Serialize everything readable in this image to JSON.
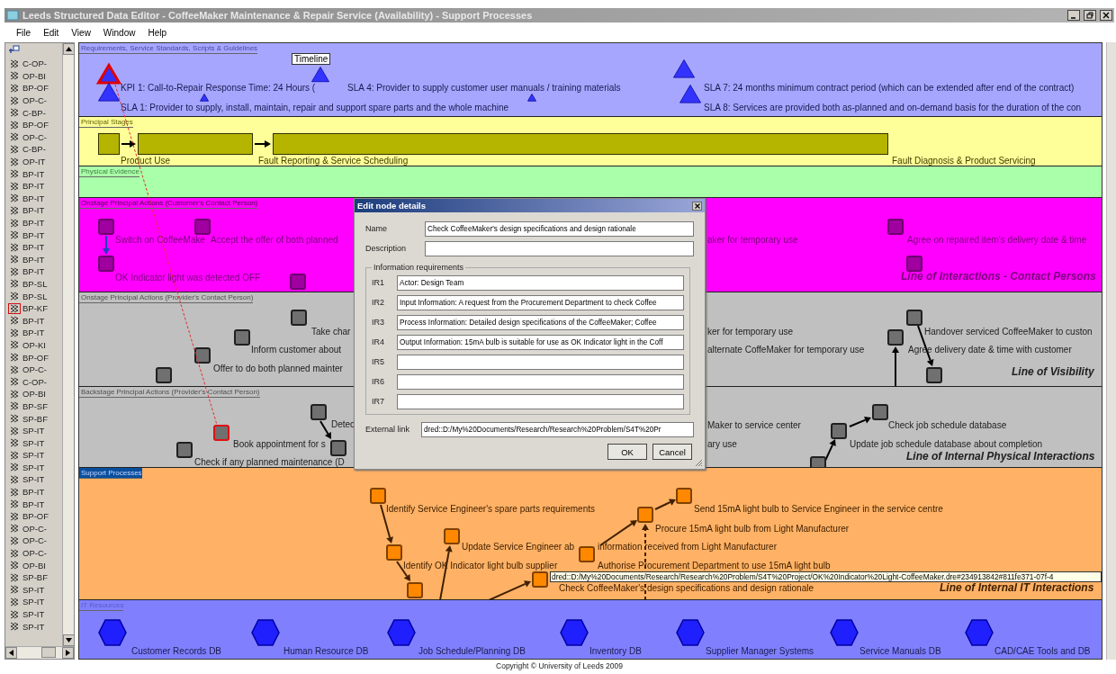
{
  "window": {
    "title": "Leeds Structured Data Editor - CoffeeMaker Maintenance & Repair Service (Availability) - Support Processes"
  },
  "menu": [
    "File",
    "Edit",
    "View",
    "Window",
    "Help"
  ],
  "tree": [
    {
      "label": "C-OP-",
      "selected": false
    },
    {
      "label": "OP-BI",
      "selected": false
    },
    {
      "label": "BP-OF",
      "selected": false
    },
    {
      "label": "OP-C-",
      "selected": false
    },
    {
      "label": "C-BP-",
      "selected": false
    },
    {
      "label": "BP-OF",
      "selected": false
    },
    {
      "label": "OP-C-",
      "selected": false
    },
    {
      "label": "C-BP-",
      "selected": false
    },
    {
      "label": "OP-IT",
      "selected": false
    },
    {
      "label": "BP-IT",
      "selected": false
    },
    {
      "label": "BP-IT",
      "selected": false
    },
    {
      "label": "BP-IT",
      "selected": false
    },
    {
      "label": "BP-IT",
      "selected": false
    },
    {
      "label": "BP-IT",
      "selected": false
    },
    {
      "label": "BP-IT",
      "selected": false
    },
    {
      "label": "BP-IT",
      "selected": false
    },
    {
      "label": "BP-IT",
      "selected": false
    },
    {
      "label": "BP-IT",
      "selected": false
    },
    {
      "label": "BP-SL",
      "selected": false
    },
    {
      "label": "BP-SL",
      "selected": false
    },
    {
      "label": "BP-KF",
      "selected": true
    },
    {
      "label": "BP-IT",
      "selected": false
    },
    {
      "label": "BP-IT",
      "selected": false
    },
    {
      "label": "OP-KI",
      "selected": false
    },
    {
      "label": "BP-OF",
      "selected": false
    },
    {
      "label": "OP-C-",
      "selected": false
    },
    {
      "label": "C-OP-",
      "selected": false
    },
    {
      "label": "OP-BI",
      "selected": false
    },
    {
      "label": "BP-SF",
      "selected": false
    },
    {
      "label": "SP-BF",
      "selected": false
    },
    {
      "label": "SP-IT",
      "selected": false
    },
    {
      "label": "SP-IT",
      "selected": false
    },
    {
      "label": "SP-IT",
      "selected": false
    },
    {
      "label": "SP-IT",
      "selected": false
    },
    {
      "label": "SP-IT",
      "selected": false
    },
    {
      "label": "BP-IT",
      "selected": false
    },
    {
      "label": "BP-IT",
      "selected": false
    },
    {
      "label": "BP-OF",
      "selected": false
    },
    {
      "label": "OP-C-",
      "selected": false
    },
    {
      "label": "OP-C-",
      "selected": false
    },
    {
      "label": "OP-C-",
      "selected": false
    },
    {
      "label": "OP-BI",
      "selected": false
    },
    {
      "label": "SP-BF",
      "selected": false
    },
    {
      "label": "SP-IT",
      "selected": false
    },
    {
      "label": "SP-IT",
      "selected": false
    },
    {
      "label": "SP-IT",
      "selected": false
    },
    {
      "label": "SP-IT",
      "selected": false
    }
  ],
  "lanes": [
    {
      "kind": "requirements",
      "title": "Requirements, Service Standards, Scripts & Guidelines",
      "nodes": [
        {
          "selected": true
        },
        {
          "selected": false
        },
        {
          "selected": false
        },
        {
          "selected": false
        },
        {
          "selected": false
        },
        {
          "selected": false
        },
        {
          "selected": false
        }
      ],
      "labels": [
        {
          "kind": "tag",
          "text": "Timeline"
        },
        {
          "kind": "caption",
          "text": "KPI 1: Call-to-Repair Response Time: 24 Hours ("
        },
        {
          "kind": "caption",
          "text": "SLA 4: Provider to supply customer user manuals / training materials"
        },
        {
          "kind": "caption",
          "text": "SLA 7: 24 months minimum contract period (which can be extended after end of the contract)"
        },
        {
          "kind": "caption",
          "text": "SLA 1: Provider to supply, install, maintain, repair and support spare parts and the whole machine"
        },
        {
          "kind": "caption",
          "text": "SLA 8: Services are provided both as-planned and on-demand basis for the duration of the con"
        }
      ]
    },
    {
      "kind": "stages",
      "title": "Principal Stages",
      "nodes": [
        {
          "selected": false
        },
        {
          "selected": false
        },
        {
          "selected": false
        }
      ],
      "labels": [
        {
          "kind": "caption",
          "text": "Product Use"
        },
        {
          "kind": "caption",
          "text": "Fault Reporting & Service Scheduling"
        },
        {
          "kind": "caption",
          "text": "Fault Diagnosis & Product Servicing"
        }
      ]
    },
    {
      "kind": "evidence",
      "title": "Physical Evidence"
    },
    {
      "kind": "customer",
      "title": "Onstage Principal Actions (Customer's Contact Person)",
      "nodes": [
        {
          "selected": false
        },
        {
          "selected": false
        },
        {
          "selected": false
        },
        {
          "selected": false
        },
        {
          "selected": false
        },
        {
          "selected": false
        }
      ],
      "labels": [
        {
          "kind": "caption",
          "text": "Switch on CoffeeMake"
        },
        {
          "kind": "caption",
          "text": "Accept the offer of both planned"
        },
        {
          "kind": "caption",
          "text": "aker for temporary use"
        },
        {
          "kind": "caption",
          "text": "Agree on repaired item's delivery date & time"
        },
        {
          "kind": "caption",
          "text": "OK Indicator light was detected OFF"
        },
        {
          "kind": "line",
          "text": "Line of Interactions - Contact Persons"
        }
      ]
    },
    {
      "kind": "provider",
      "title": "Onstage Principal Actions (Provider's Contact Person)",
      "nodes": [
        {
          "selected": false
        },
        {
          "selected": false
        },
        {
          "selected": false
        },
        {
          "selected": false
        },
        {
          "selected": false
        },
        {
          "selected": false
        },
        {
          "selected": false
        }
      ],
      "labels": [
        {
          "kind": "caption",
          "text": "Take char"
        },
        {
          "kind": "caption",
          "text": "Inform customer about"
        },
        {
          "kind": "caption",
          "text": "Offer to do both planned mainter"
        },
        {
          "kind": "caption",
          "text": "ker for temporary use"
        },
        {
          "kind": "caption",
          "text": "alternate CoffeMaker for temporary use"
        },
        {
          "kind": "caption",
          "text": "Handover serviced CoffeeMaker to custon"
        },
        {
          "kind": "caption",
          "text": "Agree delivery date & time with customer"
        },
        {
          "kind": "line",
          "text": "Line of Visibility"
        }
      ]
    },
    {
      "kind": "backstage",
      "title": "Backstage Principal Actions (Provider's Contact Person)",
      "nodes": [
        {
          "selected": false
        },
        {
          "selected": true
        },
        {
          "selected": false
        },
        {
          "selected": false
        },
        {
          "selected": false
        },
        {
          "selected": false
        },
        {
          "selected": false
        }
      ],
      "labels": [
        {
          "kind": "caption",
          "text": "Detec"
        },
        {
          "kind": "caption",
          "text": "Book appointment for s"
        },
        {
          "kind": "caption",
          "text": "Check if any planned maintenance (D"
        },
        {
          "kind": "caption",
          "text": "Maker to service center"
        },
        {
          "kind": "caption",
          "text": "ary use"
        },
        {
          "kind": "caption",
          "text": "Check job schedule database"
        },
        {
          "kind": "caption",
          "text": "Update job schedule database about completion"
        },
        {
          "kind": "line",
          "text": "Line of Internal Physical Interactions"
        }
      ]
    },
    {
      "kind": "support",
      "title": "Support Processes",
      "nodes": [
        {
          "selected": false
        },
        {
          "selected": false
        },
        {
          "selected": false
        },
        {
          "selected": false
        },
        {
          "selected": false
        },
        {
          "selected": false
        },
        {
          "selected": false
        },
        {
          "selected": false
        }
      ],
      "labels": [
        {
          "kind": "caption",
          "text": "Identify Service Engineer's spare parts requirements"
        },
        {
          "kind": "caption",
          "text": "Send 15mA light bulb to Service Engineer in the service centre"
        },
        {
          "kind": "caption",
          "text": "Procure 15mA light bulb from Light Manufacturer"
        },
        {
          "kind": "caption",
          "text": "Update Service Engineer ab"
        },
        {
          "kind": "caption",
          "text": "information received from Light Manufacturer"
        },
        {
          "kind": "caption",
          "text": "Identify OK Indicator light bulb supplier"
        },
        {
          "kind": "caption",
          "text": "Authorise Procurement Department to use 15mA light bulb"
        },
        {
          "kind": "caption",
          "text": "Check CoffeeMaker's design specifications and design rationale"
        },
        {
          "kind": "line",
          "text": "Line of Internal IT Interactions"
        }
      ],
      "tooltip": "dred::D:/My%20Documents/Research/Research%20Problem/S4T%20Project/OK%20Indicator%20Light-CoffeeMaker.dre#234913842#811fe371-07f-4"
    },
    {
      "kind": "resources",
      "title": "IT Resources",
      "nodes": [
        {
          "selected": false
        },
        {
          "selected": false
        },
        {
          "selected": false
        },
        {
          "selected": false
        },
        {
          "selected": false
        },
        {
          "selected": false
        },
        {
          "selected": false
        }
      ],
      "labels": [
        {
          "kind": "caption",
          "text": "Customer Records DB"
        },
        {
          "kind": "caption",
          "text": "Human Resource DB"
        },
        {
          "kind": "caption",
          "text": "Job Schedule/Planning DB"
        },
        {
          "kind": "caption",
          "text": "Inventory DB"
        },
        {
          "kind": "caption",
          "text": "Supplier Manager Systems"
        },
        {
          "kind": "caption",
          "text": "Service Manuals DB"
        },
        {
          "kind": "caption",
          "text": "CAD/CAE Tools and DB"
        }
      ]
    }
  ],
  "dialog": {
    "title": "Edit node details",
    "fields": [
      {
        "label": "Name",
        "value": "Check CoffeeMaker's design specifications and design rationale"
      },
      {
        "label": "Description"
      }
    ],
    "group": {
      "title": "Information requirements",
      "rows": [
        {
          "label": "IR1",
          "value": "Actor: Design Team"
        },
        {
          "label": "IR2",
          "value": "Input Information: A request from the Procurement Department to check Coffee"
        },
        {
          "label": "IR3",
          "value": "Process Information: Detailed design specifications of the CoffeeMaker; Coffee"
        },
        {
          "label": "IR4",
          "value": "Output Information: 15mA bulb is suitable for use as OK Indicator light in the Coff"
        },
        {
          "label": "IR5"
        },
        {
          "label": "IR6"
        },
        {
          "label": "IR7"
        }
      ]
    },
    "external_link": {
      "label": "External link",
      "value": "dred::D:/My%20Documents/Research/Research%20Problem/S4T%20Pr"
    },
    "buttons": [
      "OK",
      "Cancel"
    ]
  },
  "footer": "Copyright © University of Leeds 2009"
}
